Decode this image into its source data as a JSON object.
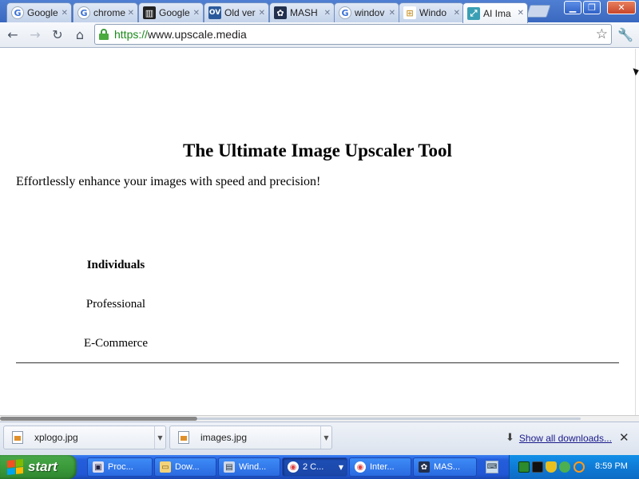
{
  "browser": {
    "tabs": [
      {
        "title": "Google",
        "icon": "google-icon"
      },
      {
        "title": "chrome",
        "icon": "google-icon"
      },
      {
        "title": "Google",
        "icon": "library-icon"
      },
      {
        "title": "Old ver",
        "icon": "oldversion-icon"
      },
      {
        "title": "MASH",
        "icon": "mash-icon"
      },
      {
        "title": "windov",
        "icon": "google-icon"
      },
      {
        "title": "Windo",
        "icon": "windows-icon"
      },
      {
        "title": "AI Ima",
        "icon": "upscale-icon",
        "active": true
      }
    ],
    "url_scheme": "https://",
    "url_host": "www.upscale.media"
  },
  "page": {
    "heading": "The Ultimate Image Upscaler Tool",
    "tagline": "Effortlessly enhance your images with speed and precision!",
    "categories": [
      "Individuals",
      "Professional",
      "E-Commerce"
    ]
  },
  "downloads": {
    "items": [
      "xplogo.jpg",
      "images.jpg"
    ],
    "show_all": "Show all downloads..."
  },
  "taskbar": {
    "start_label": "start",
    "tasks": [
      "Proc...",
      "Dow...",
      "Wind...",
      "2 C...",
      "Inter...",
      "MAS..."
    ],
    "clock": "8:59 PM"
  },
  "colors": {
    "taskbar_blue": "#245edb",
    "start_green": "#3b9b3b",
    "tray_blue": "#0f7bd6",
    "secure_green": "#1a8a1a"
  }
}
